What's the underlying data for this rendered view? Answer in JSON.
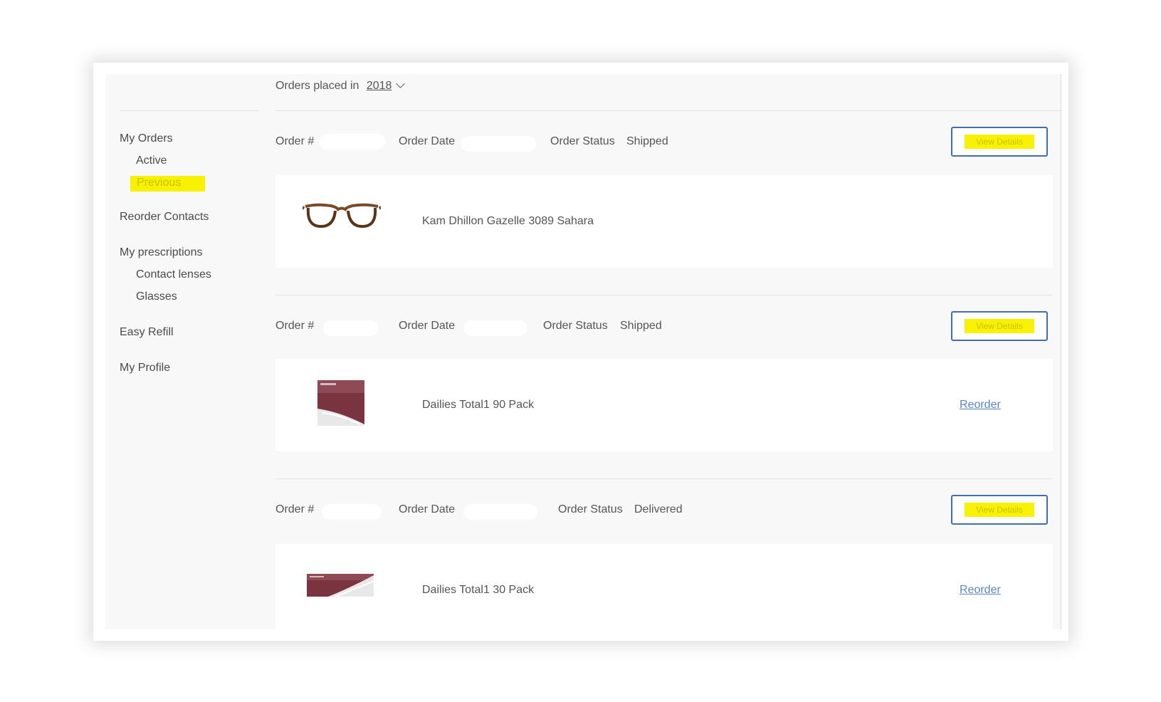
{
  "sidebar": {
    "my_orders": "My Orders",
    "active": "Active",
    "previous": "Previous",
    "reorder_contacts": "Reorder Contacts",
    "my_prescriptions": "My prescriptions",
    "contact_lenses": "Contact lenses",
    "glasses": "Glasses",
    "easy_refill": "Easy Refill",
    "my_profile": "My Profile"
  },
  "filter": {
    "label": "Orders placed in",
    "year": "2018"
  },
  "orders": [
    {
      "number_label": "Order #",
      "date_label": "Order Date",
      "status_label": "Order Status",
      "status": "Shipped",
      "button": "View Details",
      "product": "Kam Dhillon Gazelle 3089 Sahara",
      "image_icon": "eyeglasses-icon"
    },
    {
      "number_label": "Order #",
      "date_label": "Order Date",
      "status_label": "Order Status",
      "status": "Shipped",
      "button": "View Details",
      "product": "Dailies Total1 90 Pack",
      "reorder": "Reorder",
      "image_icon": "contact-lens-box-icon"
    },
    {
      "number_label": "Order #",
      "date_label": "Order Date",
      "status_label": "Order Status",
      "status": "Delivered",
      "button": "View Details",
      "product": "Dailies Total1 30 Pack",
      "reorder": "Reorder",
      "image_icon": "contact-lens-box-icon"
    }
  ],
  "colors": {
    "highlight": "#f8f200",
    "button_border": "#3f6fb0",
    "link": "#5b86c6",
    "background": "#f8f8f8"
  }
}
